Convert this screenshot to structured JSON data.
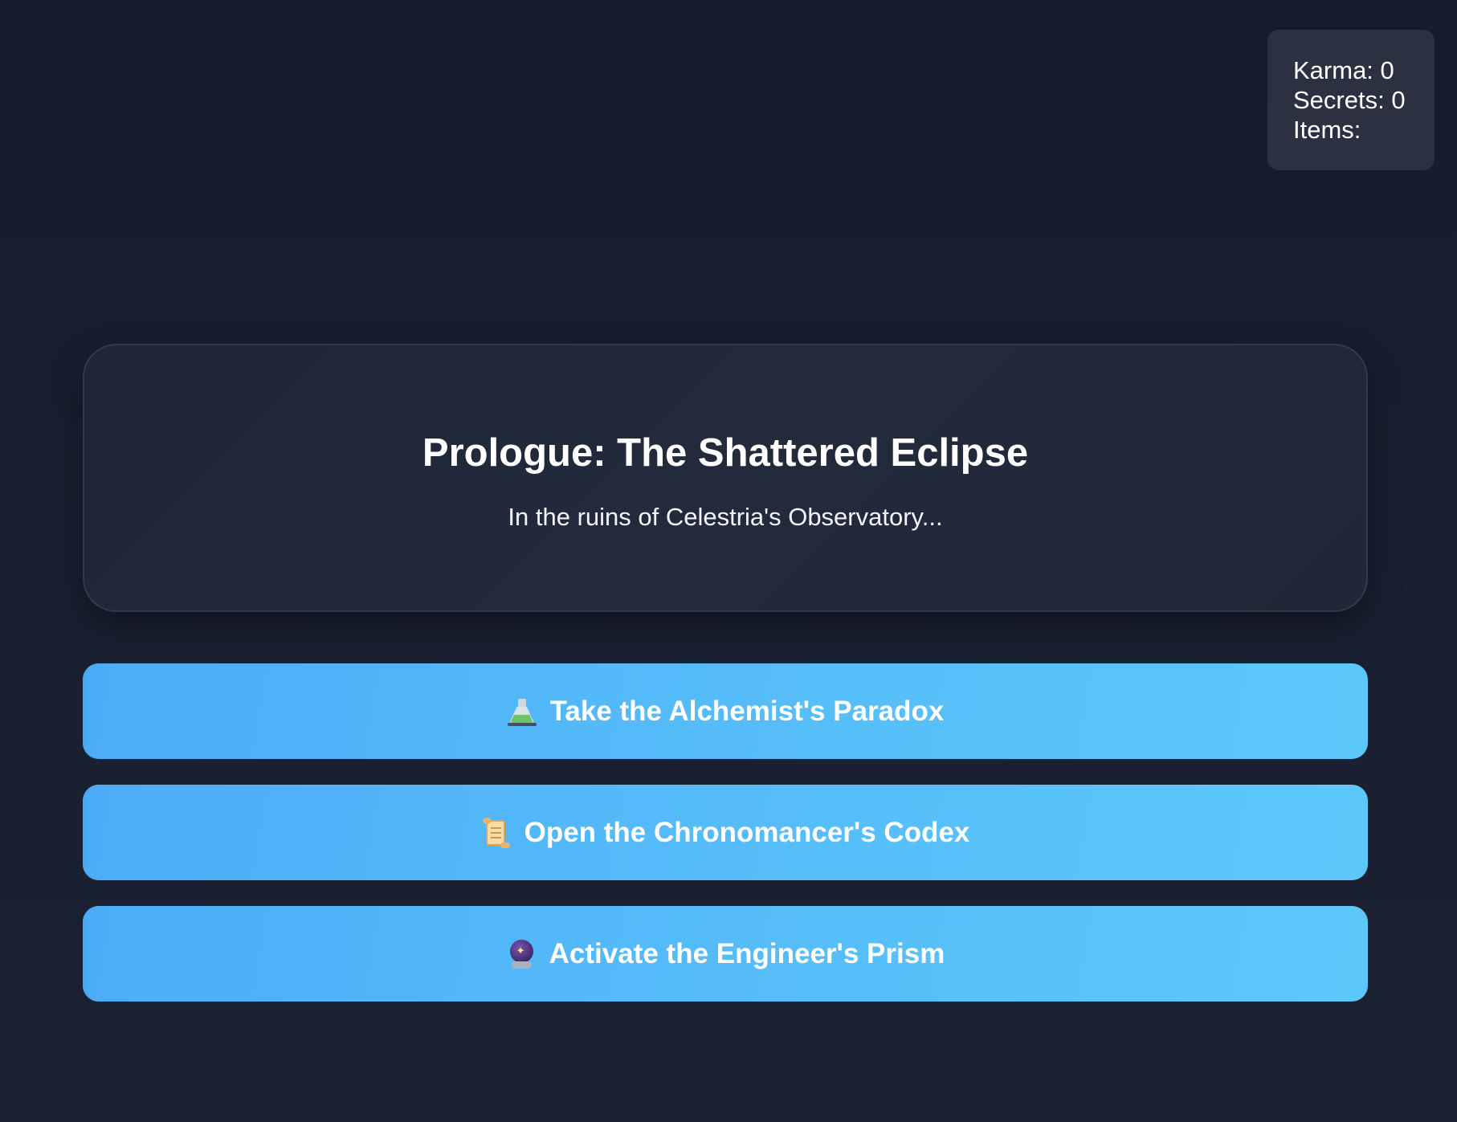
{
  "stats": {
    "karma_label": "Karma: 0",
    "secrets_label": "Secrets: 0",
    "items_label": "Items:"
  },
  "story": {
    "title": "Prologue: The Shattered Eclipse",
    "subtitle": "In the ruins of Celestria's Observatory..."
  },
  "choices": [
    {
      "label": "Take the Alchemist's Paradox",
      "icon": "flask-icon"
    },
    {
      "label": "Open the Chronomancer's Codex",
      "icon": "scroll-icon"
    },
    {
      "label": "Activate the Engineer's Prism",
      "icon": "crystal-ball-icon"
    }
  ],
  "colors": {
    "background": "#161c2c",
    "card": "#1e2738",
    "stats_panel": "#2b3141",
    "button_start": "#4dacf7",
    "button_end": "#5cc8fa"
  }
}
